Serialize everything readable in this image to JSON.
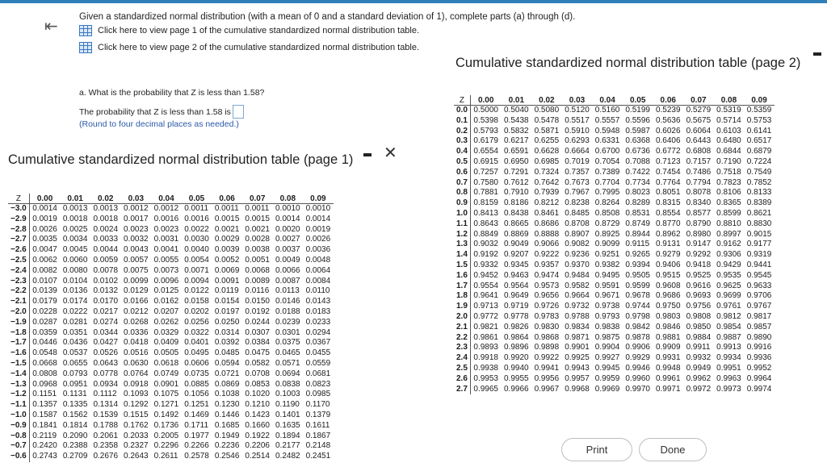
{
  "question": {
    "intro": "Given a standardized normal distribution (with a mean of 0 and a standard deviation of 1), complete parts (a) through (d).",
    "link_page1": "Click here to view page 1 of the cumulative standardized normal distribution table.",
    "link_page2": "Click here to view page 2 of the cumulative standardized normal distribution table.",
    "part_a": "a. What is the probability that Z is less than 1.58?",
    "prob_prefix": "The probability that Z is less than 1.58 is",
    "answer_value": "",
    "round_note": "(Round to four decimal places as needed.)"
  },
  "panel1": {
    "title": "Cumulative standardized normal distribution table (page 1)",
    "headers": [
      "Z",
      "0.00",
      "0.01",
      "0.02",
      "0.03",
      "0.04",
      "0.05",
      "0.06",
      "0.07",
      "0.08",
      "0.09"
    ],
    "rows": [
      [
        "−3.0",
        "0.0014",
        "0.0013",
        "0.0013",
        "0.0012",
        "0.0012",
        "0.0011",
        "0.0011",
        "0.0011",
        "0.0010",
        "0.0010"
      ],
      [
        "−2.9",
        "0.0019",
        "0.0018",
        "0.0018",
        "0.0017",
        "0.0016",
        "0.0016",
        "0.0015",
        "0.0015",
        "0.0014",
        "0.0014"
      ],
      [
        "−2.8",
        "0.0026",
        "0.0025",
        "0.0024",
        "0.0023",
        "0.0023",
        "0.0022",
        "0.0021",
        "0.0021",
        "0.0020",
        "0.0019"
      ],
      [
        "−2.7",
        "0.0035",
        "0.0034",
        "0.0033",
        "0.0032",
        "0.0031",
        "0.0030",
        "0.0029",
        "0.0028",
        "0.0027",
        "0.0026"
      ],
      [
        "−2.6",
        "0.0047",
        "0.0045",
        "0.0044",
        "0.0043",
        "0.0041",
        "0.0040",
        "0.0039",
        "0.0038",
        "0.0037",
        "0.0036"
      ],
      [
        "−2.5",
        "0.0062",
        "0.0060",
        "0.0059",
        "0.0057",
        "0.0055",
        "0.0054",
        "0.0052",
        "0.0051",
        "0.0049",
        "0.0048"
      ],
      [
        "−2.4",
        "0.0082",
        "0.0080",
        "0.0078",
        "0.0075",
        "0.0073",
        "0.0071",
        "0.0069",
        "0.0068",
        "0.0066",
        "0.0064"
      ],
      [
        "−2.3",
        "0.0107",
        "0.0104",
        "0.0102",
        "0.0099",
        "0.0096",
        "0.0094",
        "0.0091",
        "0.0089",
        "0.0087",
        "0.0084"
      ],
      [
        "−2.2",
        "0.0139",
        "0.0136",
        "0.0132",
        "0.0129",
        "0.0125",
        "0.0122",
        "0.0119",
        "0.0116",
        "0.0113",
        "0.0110"
      ],
      [
        "−2.1",
        "0.0179",
        "0.0174",
        "0.0170",
        "0.0166",
        "0.0162",
        "0.0158",
        "0.0154",
        "0.0150",
        "0.0146",
        "0.0143"
      ],
      [
        "−2.0",
        "0.0228",
        "0.0222",
        "0.0217",
        "0.0212",
        "0.0207",
        "0.0202",
        "0.0197",
        "0.0192",
        "0.0188",
        "0.0183"
      ],
      [
        "−1.9",
        "0.0287",
        "0.0281",
        "0.0274",
        "0.0268",
        "0.0262",
        "0.0256",
        "0.0250",
        "0.0244",
        "0.0239",
        "0.0233"
      ],
      [
        "−1.8",
        "0.0359",
        "0.0351",
        "0.0344",
        "0.0336",
        "0.0329",
        "0.0322",
        "0.0314",
        "0.0307",
        "0.0301",
        "0.0294"
      ],
      [
        "−1.7",
        "0.0446",
        "0.0436",
        "0.0427",
        "0.0418",
        "0.0409",
        "0.0401",
        "0.0392",
        "0.0384",
        "0.0375",
        "0.0367"
      ],
      [
        "−1.6",
        "0.0548",
        "0.0537",
        "0.0526",
        "0.0516",
        "0.0505",
        "0.0495",
        "0.0485",
        "0.0475",
        "0.0465",
        "0.0455"
      ],
      [
        "−1.5",
        "0.0668",
        "0.0655",
        "0.0643",
        "0.0630",
        "0.0618",
        "0.0606",
        "0.0594",
        "0.0582",
        "0.0571",
        "0.0559"
      ],
      [
        "−1.4",
        "0.0808",
        "0.0793",
        "0.0778",
        "0.0764",
        "0.0749",
        "0.0735",
        "0.0721",
        "0.0708",
        "0.0694",
        "0.0681"
      ],
      [
        "−1.3",
        "0.0968",
        "0.0951",
        "0.0934",
        "0.0918",
        "0.0901",
        "0.0885",
        "0.0869",
        "0.0853",
        "0.0838",
        "0.0823"
      ],
      [
        "−1.2",
        "0.1151",
        "0.1131",
        "0.1112",
        "0.1093",
        "0.1075",
        "0.1056",
        "0.1038",
        "0.1020",
        "0.1003",
        "0.0985"
      ],
      [
        "−1.1",
        "0.1357",
        "0.1335",
        "0.1314",
        "0.1292",
        "0.1271",
        "0.1251",
        "0.1230",
        "0.1210",
        "0.1190",
        "0.1170"
      ],
      [
        "−1.0",
        "0.1587",
        "0.1562",
        "0.1539",
        "0.1515",
        "0.1492",
        "0.1469",
        "0.1446",
        "0.1423",
        "0.1401",
        "0.1379"
      ],
      [
        "−0.9",
        "0.1841",
        "0.1814",
        "0.1788",
        "0.1762",
        "0.1736",
        "0.1711",
        "0.1685",
        "0.1660",
        "0.1635",
        "0.1611"
      ],
      [
        "−0.8",
        "0.2119",
        "0.2090",
        "0.2061",
        "0.2033",
        "0.2005",
        "0.1977",
        "0.1949",
        "0.1922",
        "0.1894",
        "0.1867"
      ],
      [
        "−0.7",
        "0.2420",
        "0.2388",
        "0.2358",
        "0.2327",
        "0.2296",
        "0.2266",
        "0.2236",
        "0.2206",
        "0.2177",
        "0.2148"
      ],
      [
        "−0.6",
        "0.2743",
        "0.2709",
        "0.2676",
        "0.2643",
        "0.2611",
        "0.2578",
        "0.2546",
        "0.2514",
        "0.2482",
        "0.2451"
      ]
    ]
  },
  "panel2": {
    "title": "Cumulative standardized normal distribution table (page 2)",
    "headers": [
      "Z",
      "0.00",
      "0.01",
      "0.02",
      "0.03",
      "0.04",
      "0.05",
      "0.06",
      "0.07",
      "0.08",
      "0.09"
    ],
    "rows": [
      [
        "0.0",
        "0.5000",
        "0.5040",
        "0.5080",
        "0.5120",
        "0.5160",
        "0.5199",
        "0.5239",
        "0.5279",
        "0.5319",
        "0.5359"
      ],
      [
        "0.1",
        "0.5398",
        "0.5438",
        "0.5478",
        "0.5517",
        "0.5557",
        "0.5596",
        "0.5636",
        "0.5675",
        "0.5714",
        "0.5753"
      ],
      [
        "0.2",
        "0.5793",
        "0.5832",
        "0.5871",
        "0.5910",
        "0.5948",
        "0.5987",
        "0.6026",
        "0.6064",
        "0.6103",
        "0.6141"
      ],
      [
        "0.3",
        "0.6179",
        "0.6217",
        "0.6255",
        "0.6293",
        "0.6331",
        "0.6368",
        "0.6406",
        "0.6443",
        "0.6480",
        "0.6517"
      ],
      [
        "0.4",
        "0.6554",
        "0.6591",
        "0.6628",
        "0.6664",
        "0.6700",
        "0.6736",
        "0.6772",
        "0.6808",
        "0.6844",
        "0.6879"
      ],
      [
        "0.5",
        "0.6915",
        "0.6950",
        "0.6985",
        "0.7019",
        "0.7054",
        "0.7088",
        "0.7123",
        "0.7157",
        "0.7190",
        "0.7224"
      ],
      [
        "0.6",
        "0.7257",
        "0.7291",
        "0.7324",
        "0.7357",
        "0.7389",
        "0.7422",
        "0.7454",
        "0.7486",
        "0.7518",
        "0.7549"
      ],
      [
        "0.7",
        "0.7580",
        "0.7612",
        "0.7642",
        "0.7673",
        "0.7704",
        "0.7734",
        "0.7764",
        "0.7794",
        "0.7823",
        "0.7852"
      ],
      [
        "0.8",
        "0.7881",
        "0.7910",
        "0.7939",
        "0.7967",
        "0.7995",
        "0.8023",
        "0.8051",
        "0.8078",
        "0.8106",
        "0.8133"
      ],
      [
        "0.9",
        "0.8159",
        "0.8186",
        "0.8212",
        "0.8238",
        "0.8264",
        "0.8289",
        "0.8315",
        "0.8340",
        "0.8365",
        "0.8389"
      ],
      [
        "1.0",
        "0.8413",
        "0.8438",
        "0.8461",
        "0.8485",
        "0.8508",
        "0.8531",
        "0.8554",
        "0.8577",
        "0.8599",
        "0.8621"
      ],
      [
        "1.1",
        "0.8643",
        "0.8665",
        "0.8686",
        "0.8708",
        "0.8729",
        "0.8749",
        "0.8770",
        "0.8790",
        "0.8810",
        "0.8830"
      ],
      [
        "1.2",
        "0.8849",
        "0.8869",
        "0.8888",
        "0.8907",
        "0.8925",
        "0.8944",
        "0.8962",
        "0.8980",
        "0.8997",
        "0.9015"
      ],
      [
        "1.3",
        "0.9032",
        "0.9049",
        "0.9066",
        "0.9082",
        "0.9099",
        "0.9115",
        "0.9131",
        "0.9147",
        "0.9162",
        "0.9177"
      ],
      [
        "1.4",
        "0.9192",
        "0.9207",
        "0.9222",
        "0.9236",
        "0.9251",
        "0.9265",
        "0.9279",
        "0.9292",
        "0.9306",
        "0.9319"
      ],
      [
        "1.5",
        "0.9332",
        "0.9345",
        "0.9357",
        "0.9370",
        "0.9382",
        "0.9394",
        "0.9406",
        "0.9418",
        "0.9429",
        "0.9441"
      ],
      [
        "1.6",
        "0.9452",
        "0.9463",
        "0.9474",
        "0.9484",
        "0.9495",
        "0.9505",
        "0.9515",
        "0.9525",
        "0.9535",
        "0.9545"
      ],
      [
        "1.7",
        "0.9554",
        "0.9564",
        "0.9573",
        "0.9582",
        "0.9591",
        "0.9599",
        "0.9608",
        "0.9616",
        "0.9625",
        "0.9633"
      ],
      [
        "1.8",
        "0.9641",
        "0.9649",
        "0.9656",
        "0.9664",
        "0.9671",
        "0.9678",
        "0.9686",
        "0.9693",
        "0.9699",
        "0.9706"
      ],
      [
        "1.9",
        "0.9713",
        "0.9719",
        "0.9726",
        "0.9732",
        "0.9738",
        "0.9744",
        "0.9750",
        "0.9756",
        "0.9761",
        "0.9767"
      ],
      [
        "2.0",
        "0.9772",
        "0.9778",
        "0.9783",
        "0.9788",
        "0.9793",
        "0.9798",
        "0.9803",
        "0.9808",
        "0.9812",
        "0.9817"
      ],
      [
        "2.1",
        "0.9821",
        "0.9826",
        "0.9830",
        "0.9834",
        "0.9838",
        "0.9842",
        "0.9846",
        "0.9850",
        "0.9854",
        "0.9857"
      ],
      [
        "2.2",
        "0.9861",
        "0.9864",
        "0.9868",
        "0.9871",
        "0.9875",
        "0.9878",
        "0.9881",
        "0.9884",
        "0.9887",
        "0.9890"
      ],
      [
        "2.3",
        "0.9893",
        "0.9896",
        "0.9898",
        "0.9901",
        "0.9904",
        "0.9906",
        "0.9909",
        "0.9911",
        "0.9913",
        "0.9916"
      ],
      [
        "2.4",
        "0.9918",
        "0.9920",
        "0.9922",
        "0.9925",
        "0.9927",
        "0.9929",
        "0.9931",
        "0.9932",
        "0.9934",
        "0.9936"
      ],
      [
        "2.5",
        "0.9938",
        "0.9940",
        "0.9941",
        "0.9943",
        "0.9945",
        "0.9946",
        "0.9948",
        "0.9949",
        "0.9951",
        "0.9952"
      ],
      [
        "2.6",
        "0.9953",
        "0.9955",
        "0.9956",
        "0.9957",
        "0.9959",
        "0.9960",
        "0.9961",
        "0.9962",
        "0.9963",
        "0.9964"
      ],
      [
        "2.7",
        "0.9965",
        "0.9966",
        "0.9967",
        "0.9968",
        "0.9969",
        "0.9970",
        "0.9971",
        "0.9972",
        "0.9973",
        "0.9974"
      ]
    ]
  },
  "buttons": {
    "print": "Print",
    "done": "Done"
  },
  "icons": {
    "collapse": "⇤",
    "close": "✕"
  },
  "colors": {
    "link": "#2b5aa8",
    "accent": "#2f7fb8"
  }
}
